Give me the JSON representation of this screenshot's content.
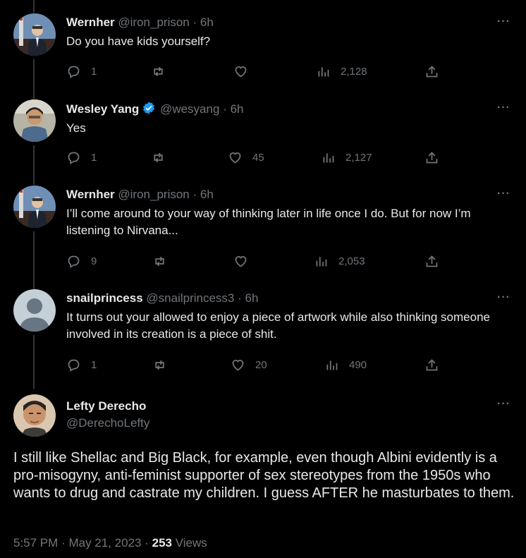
{
  "replies": [
    {
      "name": "Wernher",
      "handle": "@iron_prison",
      "time": "6h",
      "verified": false,
      "text": "Do you have kids yourself?",
      "replies": "1",
      "reposts": "",
      "likes": "",
      "views": "2,128"
    },
    {
      "name": "Wesley Yang",
      "handle": "@wesyang",
      "time": "6h",
      "verified": true,
      "text": "Yes",
      "replies": "1",
      "reposts": "",
      "likes": "45",
      "views": "2,127"
    },
    {
      "name": "Wernher",
      "handle": "@iron_prison",
      "time": "6h",
      "verified": false,
      "text": "I’ll come around to your way of thinking later in life once I do. But for now I’m listening to Nirvana...",
      "replies": "9",
      "reposts": "",
      "likes": "",
      "views": "2,053"
    },
    {
      "name": "snailprincess",
      "handle": "@snailprincess3",
      "time": "6h",
      "verified": false,
      "text": "It turns out your allowed to enjoy a piece of artwork while also thinking someone involved in its creation is a piece of shit.",
      "replies": "1",
      "reposts": "",
      "likes": "20",
      "views": "490"
    }
  ],
  "main_tweet": {
    "name": "Lefty Derecho",
    "handle": "@DerechoLefty",
    "text": "I still like Shellac and Big Black, for example, even though Albini evidently is a pro-misogyny, anti-feminist supporter of sex stereotypes from the 1950s who wants to drug and castrate my children. I guess AFTER he masturbates to them.",
    "time": "5:57 PM",
    "date": "May 21, 2023",
    "separator": "·",
    "views_count": "253",
    "views_label": "Views"
  },
  "ui": {
    "more_label": "···",
    "dot": "·"
  },
  "colors": {
    "background": "#000000",
    "text": "#e7e9ea",
    "secondary": "#71767b",
    "verified": "#1d9bf0",
    "thread_line": "#333639"
  }
}
